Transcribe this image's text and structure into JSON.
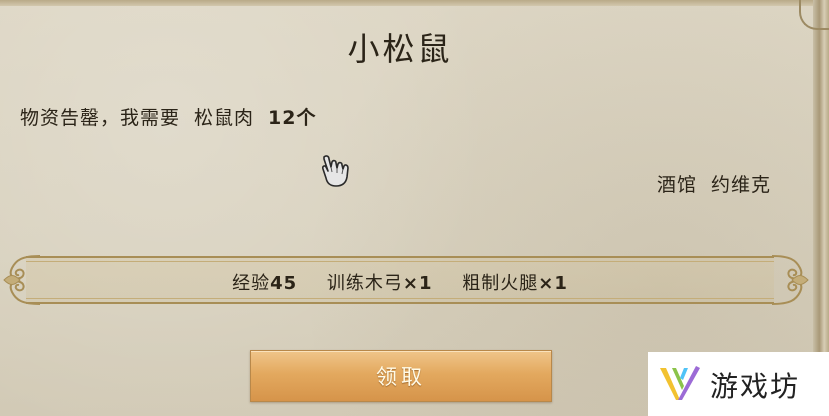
{
  "dialog": {
    "title": "小松鼠",
    "request_text": "物资告罄，我需要",
    "item_name": "松鼠肉",
    "item_count": "12个",
    "npc_location": "酒馆",
    "npc_name": "约维克"
  },
  "rewards": [
    {
      "label": "经验",
      "amount": "45"
    },
    {
      "label": "训练木弓",
      "amount": "×1"
    },
    {
      "label": "粗制火腿",
      "amount": "×1"
    }
  ],
  "claim_button": {
    "label": "领取"
  },
  "watermark": {
    "text": "游戏坊"
  },
  "colors": {
    "parchment": "#d9d2bf",
    "text": "#2b2418",
    "button": "#e3a95f",
    "border_gold": "#a88e56"
  }
}
